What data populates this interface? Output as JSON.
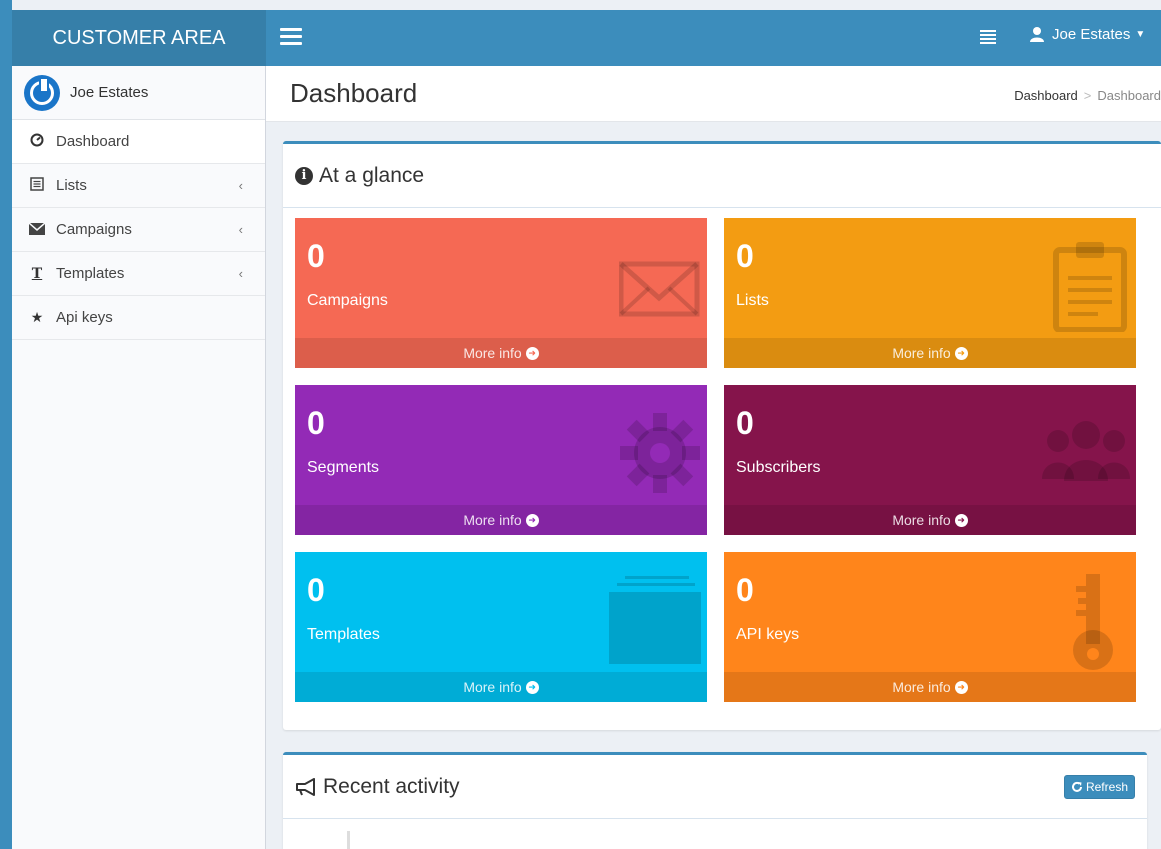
{
  "brand": {
    "title": "CUSTOMER AREA"
  },
  "topbar": {
    "user_name": "Joe Estates"
  },
  "sidebar": {
    "user_name": "Joe Estates",
    "items": [
      {
        "label": "Dashboard",
        "icon": "dashboard-icon"
      },
      {
        "label": "Lists",
        "icon": "list-icon"
      },
      {
        "label": "Campaigns",
        "icon": "envelope-icon"
      },
      {
        "label": "Templates",
        "icon": "text-icon"
      },
      {
        "label": "Api keys",
        "icon": "star-icon"
      }
    ]
  },
  "header": {
    "title": "Dashboard",
    "breadcrumb": [
      "Dashboard",
      "Dashboard"
    ]
  },
  "glance": {
    "title": "At a glance",
    "more_label": "More info",
    "tiles": [
      {
        "value": "0",
        "label": "Campaigns",
        "color": "#f56954"
      },
      {
        "value": "0",
        "label": "Lists",
        "color": "#f39c12"
      },
      {
        "value": "0",
        "label": "Segments",
        "color": "#932ab6"
      },
      {
        "value": "0",
        "label": "Subscribers",
        "color": "#85144b"
      },
      {
        "value": "0",
        "label": "Templates",
        "color": "#00c0ef"
      },
      {
        "value": "0",
        "label": "API keys",
        "color": "#ff851b"
      }
    ]
  },
  "activity": {
    "title": "Recent activity",
    "refresh_label": "Refresh"
  }
}
